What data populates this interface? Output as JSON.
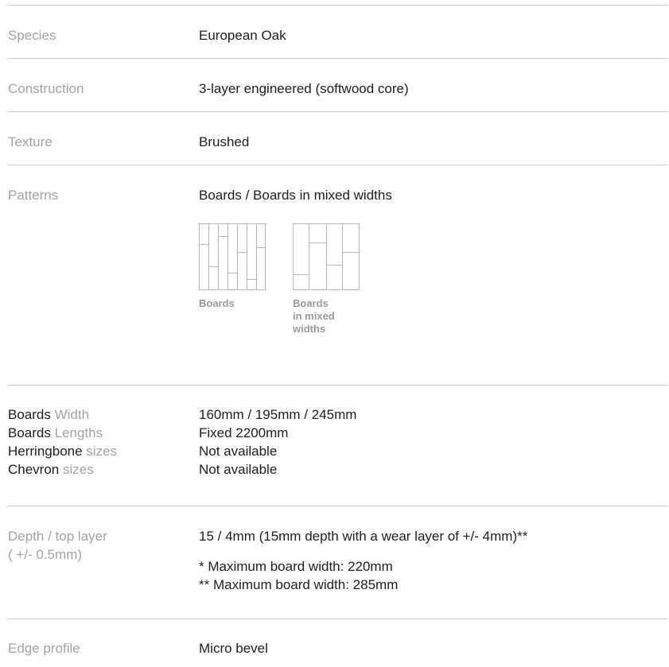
{
  "specs": {
    "species": {
      "label": "Species",
      "value": "European Oak"
    },
    "construction": {
      "label": "Construction",
      "value": "3-layer engineered (softwood core)"
    },
    "texture": {
      "label": "Texture",
      "value": "Brushed"
    },
    "patterns": {
      "label": "Patterns",
      "value": "Boards / Boards in mixed widths",
      "items": [
        {
          "caption": "Boards",
          "icon": "boards-pattern-icon"
        },
        {
          "caption": "Boards in mixed widths",
          "icon": "mixed-width-boards-pattern-icon"
        }
      ]
    },
    "sizes": [
      {
        "strong": "Boards",
        "dim": "Width",
        "value": "160mm / 195mm / 245mm"
      },
      {
        "strong": "Boards",
        "dim": "Lengths",
        "value": "Fixed 2200mm"
      },
      {
        "strong": "Herringbone",
        "dim": "sizes",
        "value": "Not available"
      },
      {
        "strong": "Chevron",
        "dim": "sizes",
        "value": "Not available"
      }
    ],
    "depth": {
      "label_line1": "Depth / top layer",
      "label_line2": "( +/- 0.5mm)",
      "value": "15 / 4mm (15mm depth with a wear layer of +/- 4mm)**",
      "notes": [
        "* Maximum board width: 220mm",
        "** Maximum board width: 285mm"
      ]
    },
    "edge": {
      "label": "Edge profile",
      "value": "Micro bevel"
    }
  },
  "colors": {
    "text": "#1e1e1e",
    "muted": "#a3a3a3",
    "divider": "#c9c9c9",
    "pattern_stroke": "#b8b8b8"
  }
}
